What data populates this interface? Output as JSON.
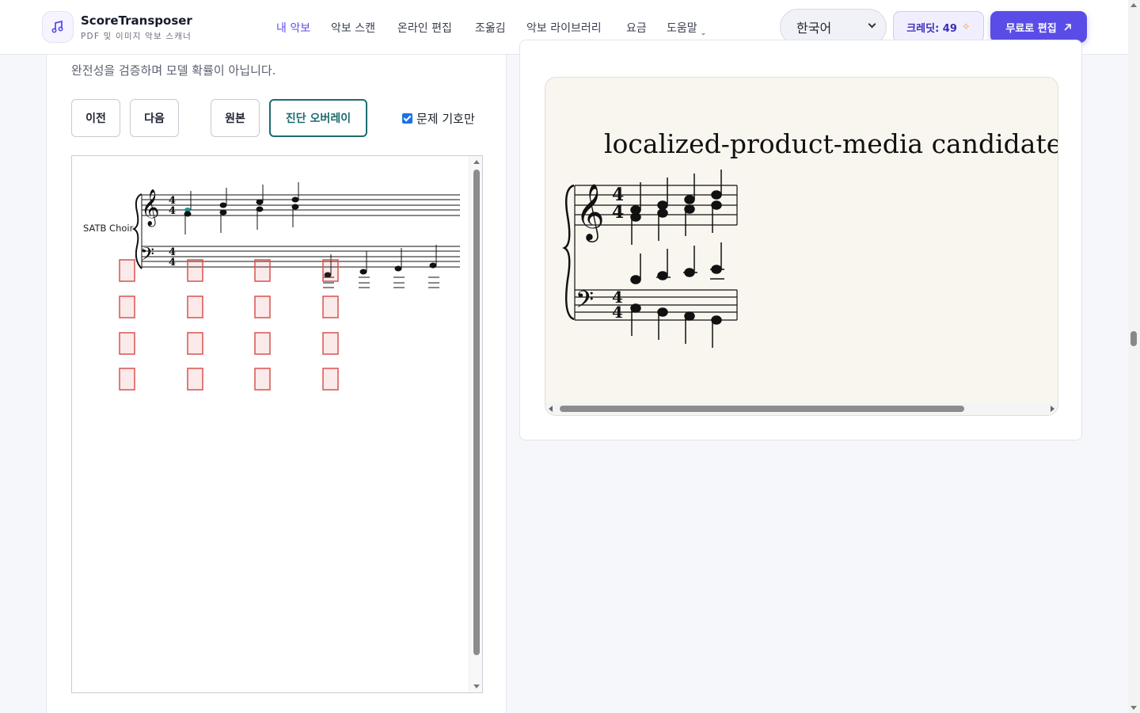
{
  "header": {
    "brand_title": "ScoreTransposer",
    "brand_subtitle": "PDF 및 이미지 악보 스캐너",
    "logo_icon": "music-note-icon",
    "nav": [
      {
        "label": "내 악보",
        "active": true
      },
      {
        "label": "악보 스캔",
        "active": false
      },
      {
        "label": "온라인 편집",
        "active": false
      },
      {
        "label": "조옮김",
        "active": false
      },
      {
        "label": "악보 라이브러리",
        "active": false
      },
      {
        "label": "요금",
        "active": false
      },
      {
        "label": "도움말",
        "active": false,
        "has_dropdown": true
      }
    ],
    "language": "한국어",
    "credits_label": "크레딧: 49",
    "cta_label": "무료로 편집"
  },
  "left_panel": {
    "note": "완전성을 검증하며 모델 확률이 아닙니다.",
    "buttons": {
      "prev": "이전",
      "next": "다음",
      "original": "원본",
      "diagnostic_overlay": "진단 오버레이"
    },
    "checkbox": {
      "label": "문제 기호만",
      "checked": true
    },
    "score": {
      "part_label": "SATB Choir",
      "time_signature": "4/4"
    }
  },
  "right_panel": {
    "preview_title": "localized-product-media candidate s",
    "time_signature": "4/4"
  },
  "colors": {
    "accent": "#5a4ce6",
    "overlay_selected": "#1c6b6f",
    "issue_box": "#d9534f",
    "preview_bg": "#f9f6ef"
  }
}
